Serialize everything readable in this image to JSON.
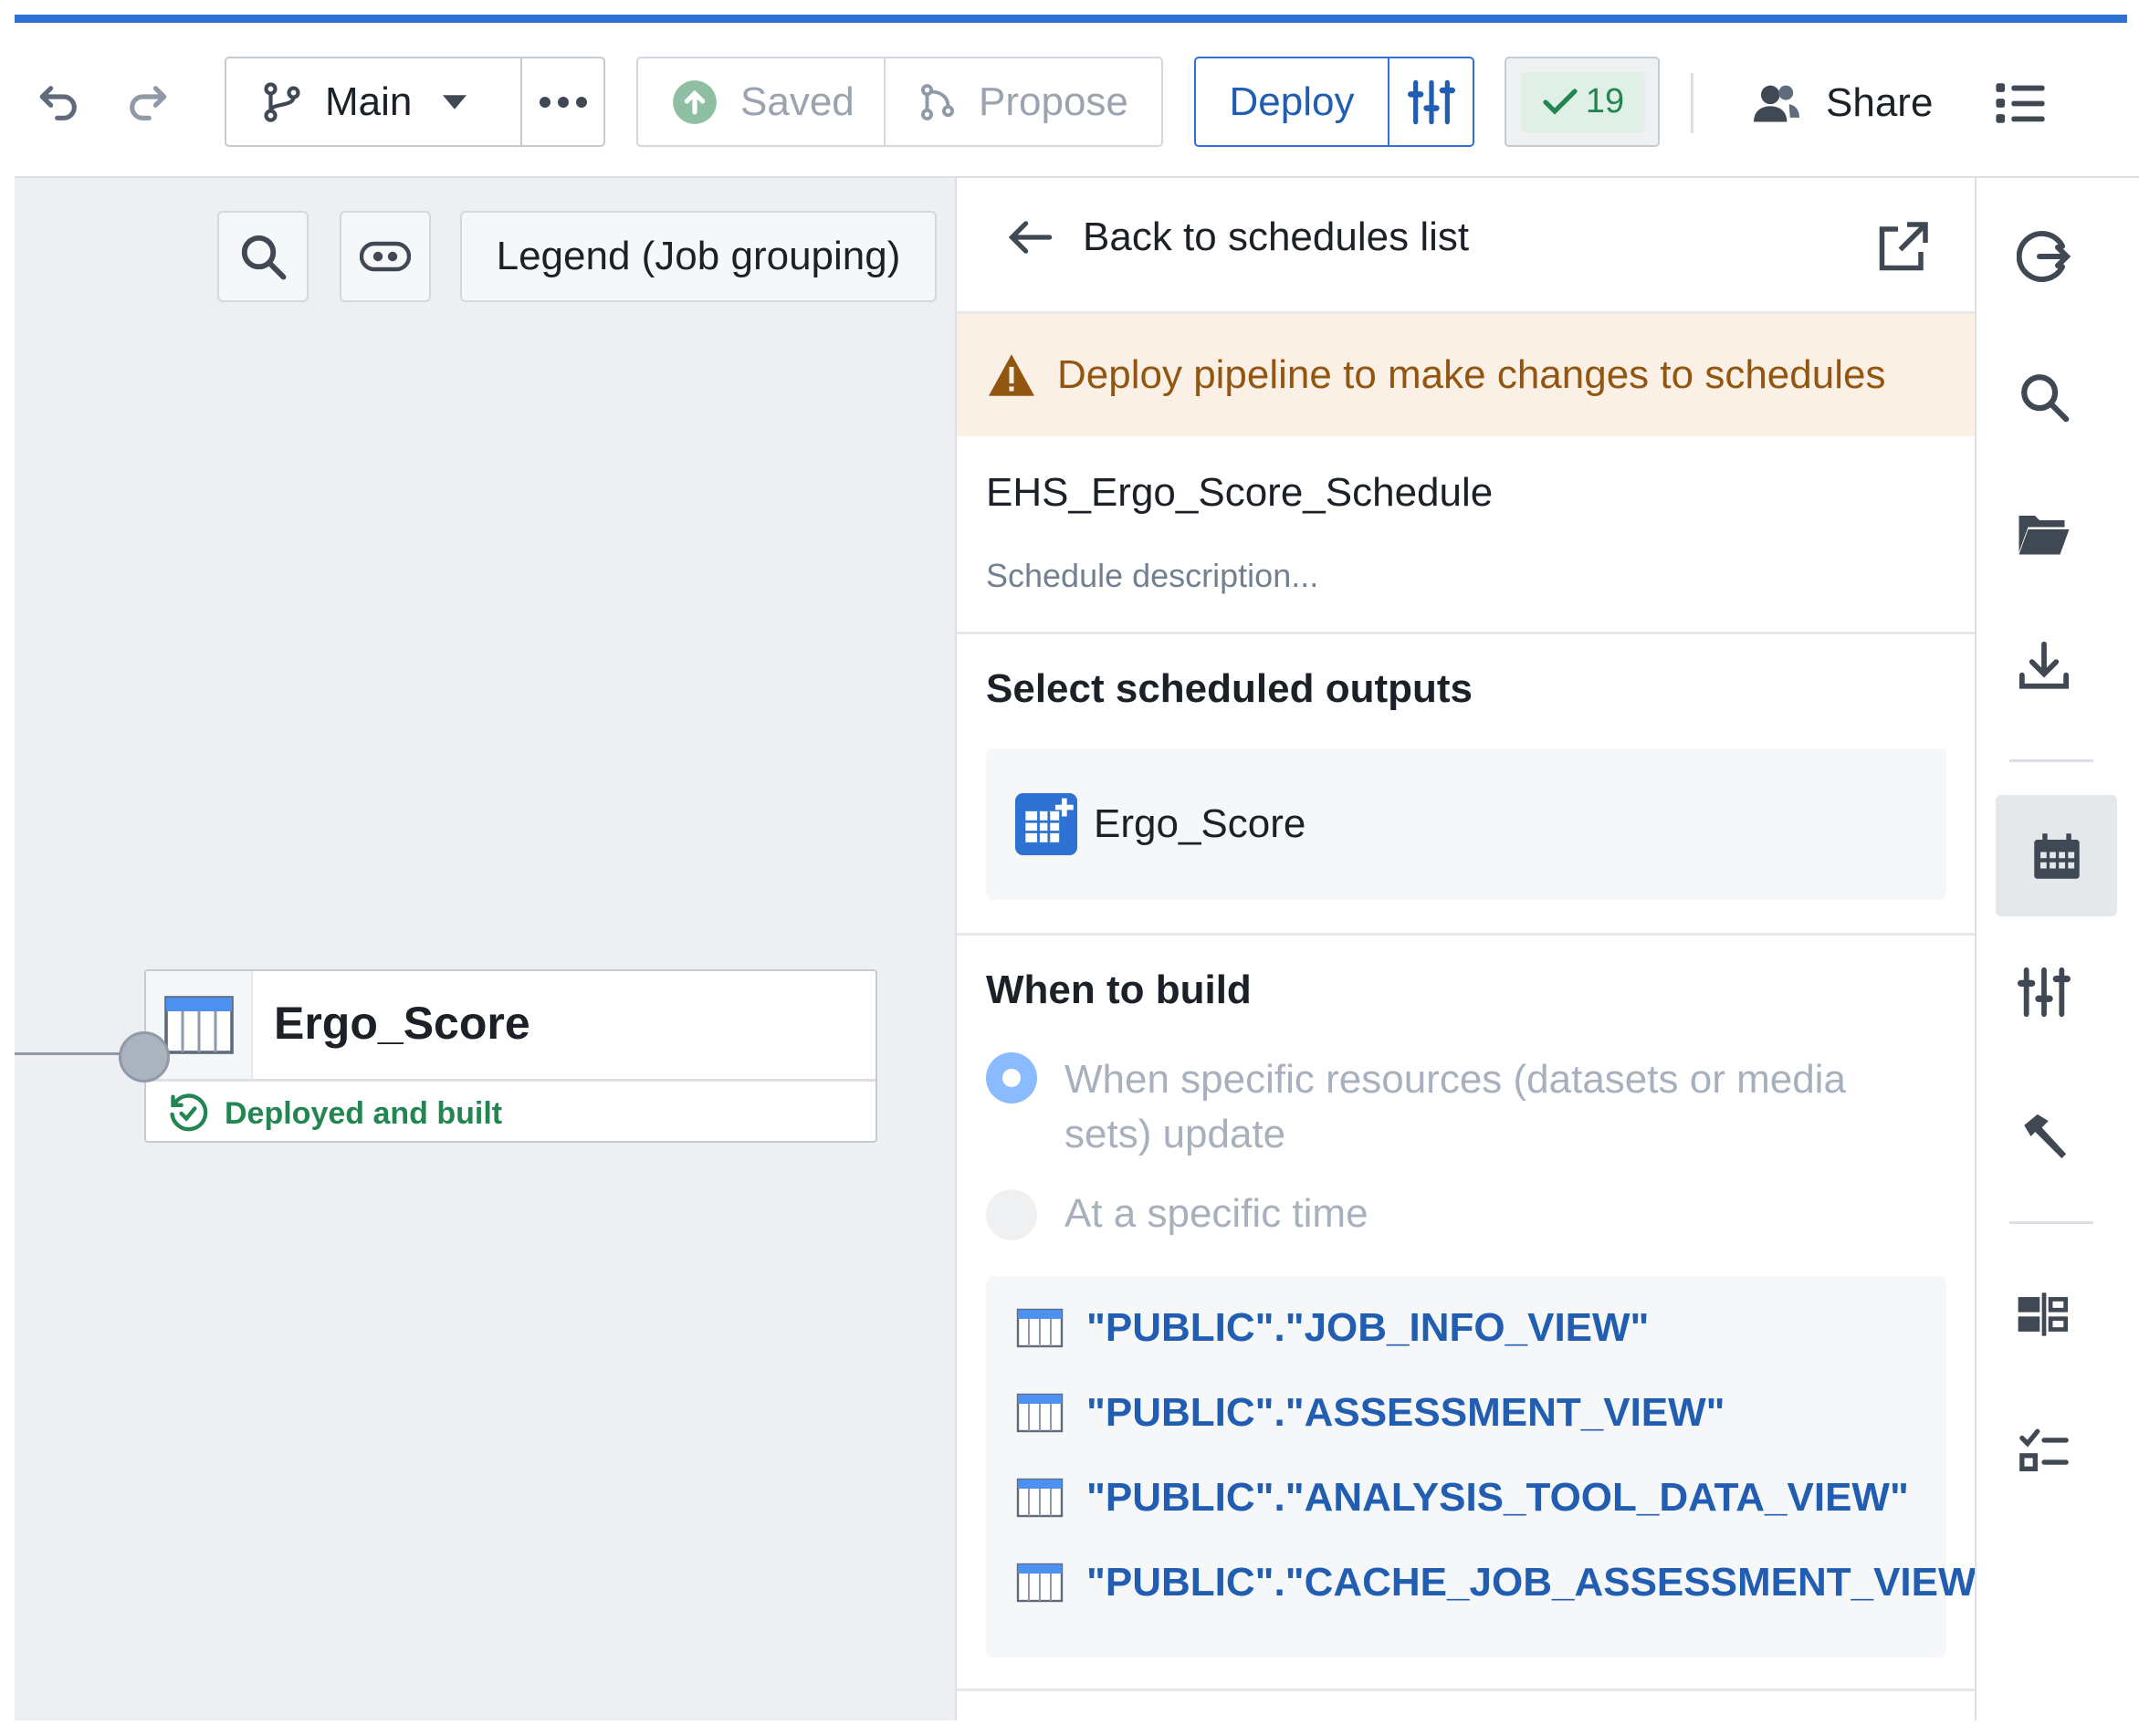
{
  "toolbar": {
    "undo_icon": "undo-icon",
    "redo_icon": "redo-icon",
    "branch": {
      "icon": "git-branch-icon",
      "label": "Main",
      "caret": "caret-down-icon"
    },
    "more_icon": "more-horizontal-icon",
    "saved": {
      "icon": "upload-circle-icon",
      "label": "Saved"
    },
    "propose": {
      "icon": "git-pull-icon",
      "label": "Propose"
    },
    "deploy": {
      "label": "Deploy",
      "settings_icon": "sliders-icon"
    },
    "checks": {
      "icon": "tick-icon",
      "count": "19"
    },
    "share": {
      "icon": "people-icon",
      "label": "Share"
    },
    "list_icon": "properties-icon"
  },
  "canvas": {
    "search_icon": "search-icon",
    "view_icon": "eye-toggle-icon",
    "legend_label": "Legend (Job grouping)",
    "node": {
      "title": "Ergo_Score",
      "icon": "dataset-table-icon",
      "status": "Deployed and built",
      "status_icon": "history-check-icon",
      "status_color": "#238551"
    }
  },
  "panel": {
    "back_label": "Back to schedules list",
    "back_icon": "arrow-left-icon",
    "external_icon": "share-external-icon",
    "warning": {
      "icon": "warning-sign-icon",
      "text": "Deploy pipeline to make changes to schedules",
      "bg": "#fbf0e6",
      "color": "#935610"
    },
    "schedule_name": "EHS_Ergo_Score_Schedule",
    "schedule_description_placeholder": "Schedule description...",
    "outputs": {
      "title": "Select scheduled outputs",
      "items": [
        {
          "label": "Ergo_Score",
          "icon": "dataset-add-icon"
        }
      ]
    },
    "when_to_build": {
      "title": "When to build",
      "options": [
        {
          "label": "When specific resources (datasets or media sets) update",
          "selected": true
        },
        {
          "label": "At a specific time",
          "selected": false
        }
      ],
      "resources": [
        "\"PUBLIC\".\"JOB_INFO_VIEW\"",
        "\"PUBLIC\".\"ASSESSMENT_VIEW\"",
        "\"PUBLIC\".\"ANALYSIS_TOOL_DATA_VIEW\"",
        "\"PUBLIC\".\"CACHE_JOB_ASSESSMENT_VIEW\""
      ]
    }
  },
  "rail": {
    "icons": [
      "log-out-icon",
      "search-icon",
      "folder-open-icon",
      "download-icon",
      "calendar-icon",
      "sliders-icon",
      "hammer-icon",
      "align-icon",
      "checklist-icon"
    ],
    "active": "calendar-icon"
  },
  "colors": {
    "accent": "#2d72d2",
    "link": "#215db0",
    "canvas": "#edeff2"
  }
}
